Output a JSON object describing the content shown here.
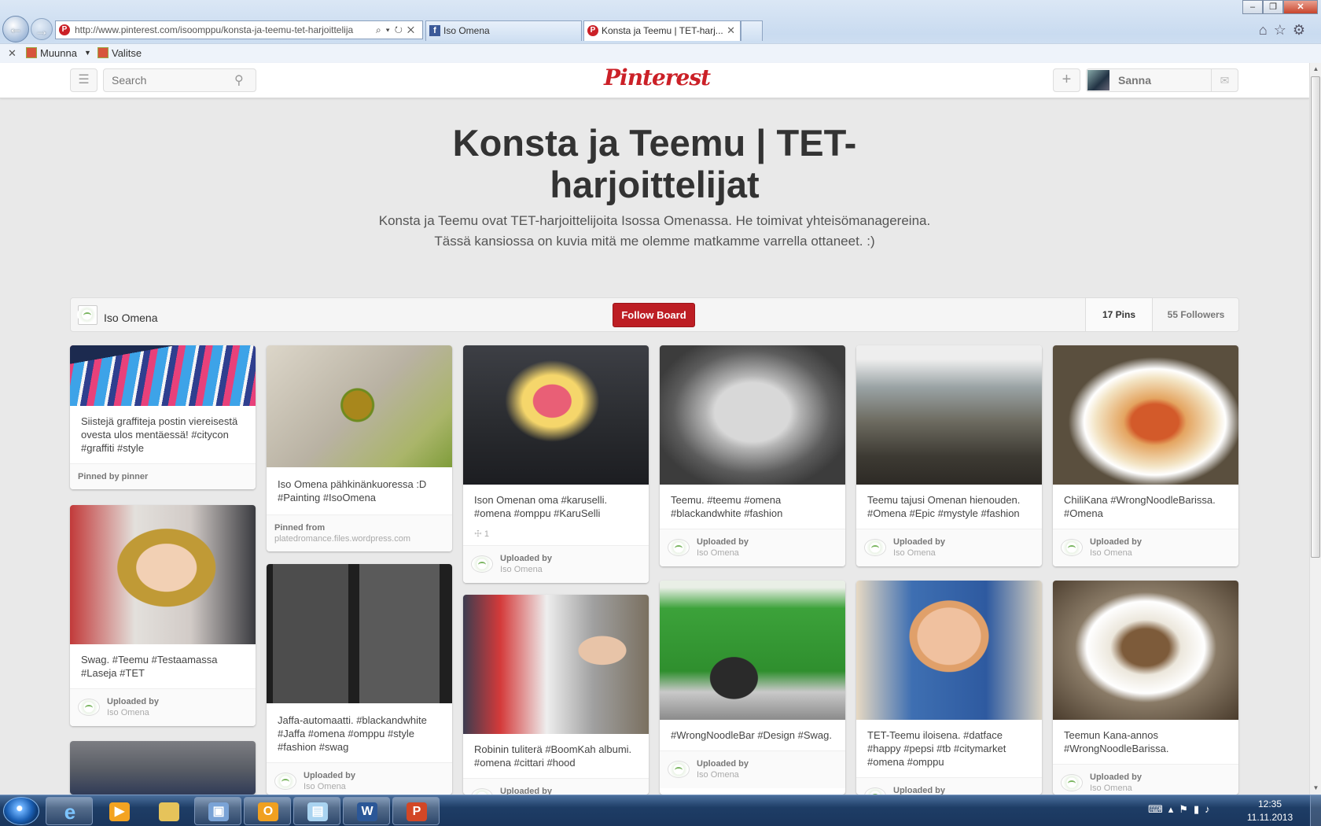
{
  "browser": {
    "address": "http://www.pinterest.com/isoomppu/konsta-ja-teemu-tet-harjoittelija",
    "tabs": [
      {
        "label": "Iso Omena"
      },
      {
        "label": "Konsta ja Teemu | TET-harj..."
      }
    ],
    "command_bar": {
      "muunna": "Muunna",
      "valitse": "Valitse"
    }
  },
  "header": {
    "search_placeholder": "Search",
    "logo": "Pinterest",
    "user_name": "Sanna"
  },
  "board": {
    "title": "Konsta ja Teemu | TET-harjoittelijat",
    "description": "Konsta ja Teemu ovat TET-harjoittelijoita Isossa Omenassa. He toimivat yhteisömanagereina. Tässä kansiossa on kuvia mitä me olemme matkamme varrella ottaneet. :)",
    "owner": "Iso Omena",
    "follow_label": "Follow Board",
    "pins_count": "17 Pins",
    "followers_count": "55 Followers"
  },
  "pins": [
    {
      "desc": "Siistejä graffiteja postin viereisestä ovesta ulos mentäessä! #citycon #graffiti #style",
      "footer_label": "Pinned by pinner"
    },
    {
      "desc": "Iso Omena pähkinänkuoressa :D #Painting #IsoOmena",
      "footer_label": "Pinned from",
      "footer_by": "platedromance.files.wordpress.com"
    },
    {
      "desc": "Ison Omenan oma #karuselli. #omena #omppu #KaruSelli",
      "stat": "☩ 1",
      "footer_label": "Uploaded by",
      "footer_by": "Iso Omena"
    },
    {
      "desc": "Teemu. #teemu #omena #blackandwhite #fashion",
      "footer_label": "Uploaded by",
      "footer_by": "Iso Omena"
    },
    {
      "desc": "Teemu tajusi Omenan hienouden. #Omena #Epic #mystyle #fashion",
      "footer_label": "Uploaded by",
      "footer_by": "Iso Omena"
    },
    {
      "desc": "ChiliKana #WrongNoodleBarissa. #Omena",
      "footer_label": "Uploaded by",
      "footer_by": "Iso Omena"
    },
    {
      "desc": "Swag. #Teemu #Testaamassa #Laseja #TET",
      "footer_label": "Uploaded by",
      "footer_by": "Iso Omena"
    },
    {
      "desc": "Jaffa-automaatti. #blackandwhite #Jaffa #omena #omppu #style #fashion #swag",
      "footer_label": "Uploaded by",
      "footer_by": "Iso Omena"
    },
    {
      "desc": "Robinin tuliterä #BoomKah albumi. #omena #cittari #hood",
      "footer_label": "Uploaded by"
    },
    {
      "desc": "#WrongNoodleBar #Design #Swag.",
      "footer_label": "Uploaded by",
      "footer_by": "Iso Omena"
    },
    {
      "desc": "TET-Teemu iloisena. #datface #happy #pepsi #tb #citymarket #omena #omppu",
      "footer_label": "Uploaded by"
    },
    {
      "desc": "Teemun Kana-annos #WrongNoodleBarissa.",
      "footer_label": "Uploaded by",
      "footer_by": "Iso Omena"
    }
  ],
  "taskbar": {
    "time": "12:35",
    "date": "11.11.2013"
  }
}
